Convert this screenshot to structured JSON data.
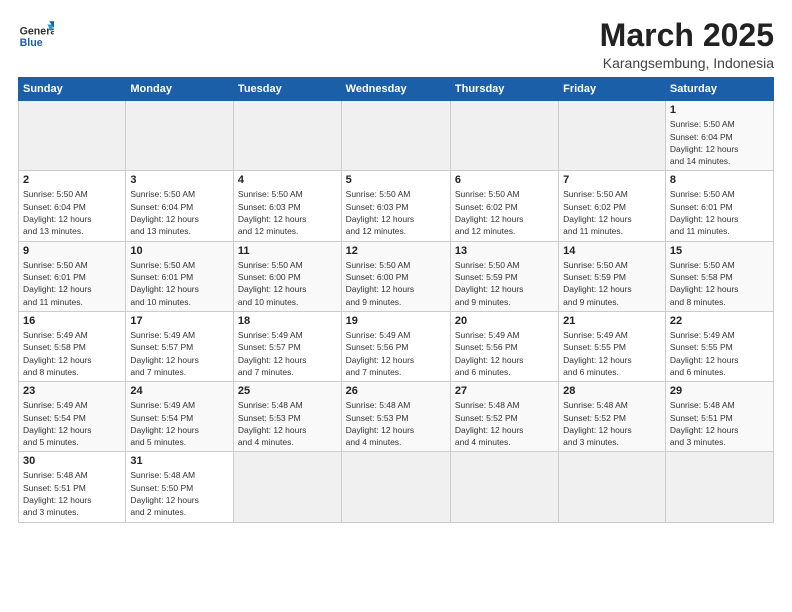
{
  "logo": {
    "line1": "General",
    "line2": "Blue"
  },
  "title": "March 2025",
  "location": "Karangsembung, Indonesia",
  "weekdays": [
    "Sunday",
    "Monday",
    "Tuesday",
    "Wednesday",
    "Thursday",
    "Friday",
    "Saturday"
  ],
  "weeks": [
    [
      {
        "day": "",
        "info": ""
      },
      {
        "day": "",
        "info": ""
      },
      {
        "day": "",
        "info": ""
      },
      {
        "day": "",
        "info": ""
      },
      {
        "day": "",
        "info": ""
      },
      {
        "day": "",
        "info": ""
      },
      {
        "day": "1",
        "info": "Sunrise: 5:50 AM\nSunset: 6:04 PM\nDaylight: 12 hours\nand 14 minutes."
      }
    ],
    [
      {
        "day": "2",
        "info": "Sunrise: 5:50 AM\nSunset: 6:04 PM\nDaylight: 12 hours\nand 13 minutes."
      },
      {
        "day": "3",
        "info": "Sunrise: 5:50 AM\nSunset: 6:04 PM\nDaylight: 12 hours\nand 13 minutes."
      },
      {
        "day": "4",
        "info": "Sunrise: 5:50 AM\nSunset: 6:03 PM\nDaylight: 12 hours\nand 12 minutes."
      },
      {
        "day": "5",
        "info": "Sunrise: 5:50 AM\nSunset: 6:03 PM\nDaylight: 12 hours\nand 12 minutes."
      },
      {
        "day": "6",
        "info": "Sunrise: 5:50 AM\nSunset: 6:02 PM\nDaylight: 12 hours\nand 12 minutes."
      },
      {
        "day": "7",
        "info": "Sunrise: 5:50 AM\nSunset: 6:02 PM\nDaylight: 12 hours\nand 11 minutes."
      },
      {
        "day": "8",
        "info": "Sunrise: 5:50 AM\nSunset: 6:01 PM\nDaylight: 12 hours\nand 11 minutes."
      }
    ],
    [
      {
        "day": "9",
        "info": "Sunrise: 5:50 AM\nSunset: 6:01 PM\nDaylight: 12 hours\nand 11 minutes."
      },
      {
        "day": "10",
        "info": "Sunrise: 5:50 AM\nSunset: 6:01 PM\nDaylight: 12 hours\nand 10 minutes."
      },
      {
        "day": "11",
        "info": "Sunrise: 5:50 AM\nSunset: 6:00 PM\nDaylight: 12 hours\nand 10 minutes."
      },
      {
        "day": "12",
        "info": "Sunrise: 5:50 AM\nSunset: 6:00 PM\nDaylight: 12 hours\nand 9 minutes."
      },
      {
        "day": "13",
        "info": "Sunrise: 5:50 AM\nSunset: 5:59 PM\nDaylight: 12 hours\nand 9 minutes."
      },
      {
        "day": "14",
        "info": "Sunrise: 5:50 AM\nSunset: 5:59 PM\nDaylight: 12 hours\nand 9 minutes."
      },
      {
        "day": "15",
        "info": "Sunrise: 5:50 AM\nSunset: 5:58 PM\nDaylight: 12 hours\nand 8 minutes."
      }
    ],
    [
      {
        "day": "16",
        "info": "Sunrise: 5:49 AM\nSunset: 5:58 PM\nDaylight: 12 hours\nand 8 minutes."
      },
      {
        "day": "17",
        "info": "Sunrise: 5:49 AM\nSunset: 5:57 PM\nDaylight: 12 hours\nand 7 minutes."
      },
      {
        "day": "18",
        "info": "Sunrise: 5:49 AM\nSunset: 5:57 PM\nDaylight: 12 hours\nand 7 minutes."
      },
      {
        "day": "19",
        "info": "Sunrise: 5:49 AM\nSunset: 5:56 PM\nDaylight: 12 hours\nand 7 minutes."
      },
      {
        "day": "20",
        "info": "Sunrise: 5:49 AM\nSunset: 5:56 PM\nDaylight: 12 hours\nand 6 minutes."
      },
      {
        "day": "21",
        "info": "Sunrise: 5:49 AM\nSunset: 5:55 PM\nDaylight: 12 hours\nand 6 minutes."
      },
      {
        "day": "22",
        "info": "Sunrise: 5:49 AM\nSunset: 5:55 PM\nDaylight: 12 hours\nand 6 minutes."
      }
    ],
    [
      {
        "day": "23",
        "info": "Sunrise: 5:49 AM\nSunset: 5:54 PM\nDaylight: 12 hours\nand 5 minutes."
      },
      {
        "day": "24",
        "info": "Sunrise: 5:49 AM\nSunset: 5:54 PM\nDaylight: 12 hours\nand 5 minutes."
      },
      {
        "day": "25",
        "info": "Sunrise: 5:48 AM\nSunset: 5:53 PM\nDaylight: 12 hours\nand 4 minutes."
      },
      {
        "day": "26",
        "info": "Sunrise: 5:48 AM\nSunset: 5:53 PM\nDaylight: 12 hours\nand 4 minutes."
      },
      {
        "day": "27",
        "info": "Sunrise: 5:48 AM\nSunset: 5:52 PM\nDaylight: 12 hours\nand 4 minutes."
      },
      {
        "day": "28",
        "info": "Sunrise: 5:48 AM\nSunset: 5:52 PM\nDaylight: 12 hours\nand 3 minutes."
      },
      {
        "day": "29",
        "info": "Sunrise: 5:48 AM\nSunset: 5:51 PM\nDaylight: 12 hours\nand 3 minutes."
      }
    ],
    [
      {
        "day": "30",
        "info": "Sunrise: 5:48 AM\nSunset: 5:51 PM\nDaylight: 12 hours\nand 3 minutes."
      },
      {
        "day": "31",
        "info": "Sunrise: 5:48 AM\nSunset: 5:50 PM\nDaylight: 12 hours\nand 2 minutes."
      },
      {
        "day": "",
        "info": ""
      },
      {
        "day": "",
        "info": ""
      },
      {
        "day": "",
        "info": ""
      },
      {
        "day": "",
        "info": ""
      },
      {
        "day": "",
        "info": ""
      }
    ]
  ]
}
